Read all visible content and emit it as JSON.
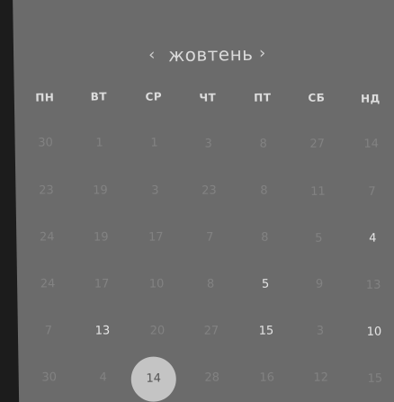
{
  "calendar": {
    "month": "жовтень",
    "prev": "‹",
    "next": "›",
    "weekdays": [
      "ПН",
      "ВТ",
      "СР",
      "ЧТ",
      "ПТ",
      "СБ",
      "НД"
    ],
    "rows": [
      [
        "30",
        "1",
        "1",
        "3",
        "8",
        "27",
        "14"
      ],
      [
        "23",
        "19",
        "3",
        "23",
        "8",
        "11",
        "7"
      ],
      [
        "24",
        "19",
        "17",
        "7",
        "8",
        "5",
        "4"
      ],
      [
        "24",
        "17",
        "10",
        "8",
        "5",
        "9",
        "13"
      ],
      [
        "7",
        "13",
        "20",
        "27",
        "15",
        "3",
        "10"
      ],
      [
        "30",
        "4",
        "14",
        "28",
        "16",
        "12",
        "15"
      ]
    ]
  }
}
